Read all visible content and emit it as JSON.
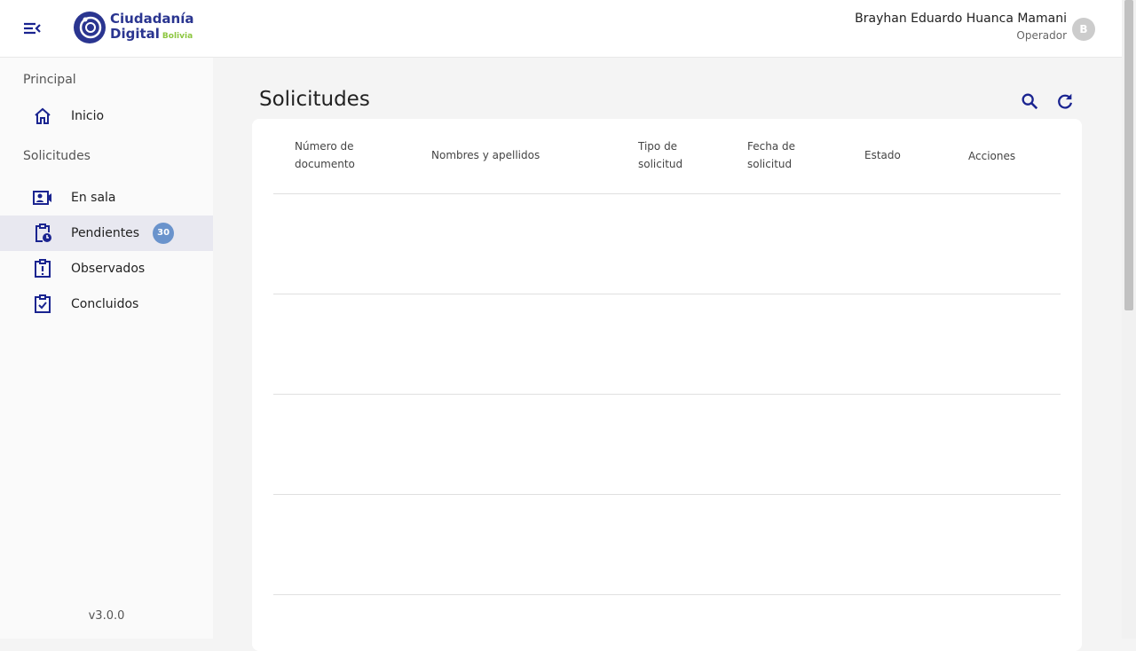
{
  "header": {
    "logo_line1": "Ciudadanía",
    "logo_line2": "Digital",
    "logo_sub": "Bolivia",
    "user_name": "Brayhan Eduardo Huanca Mamani",
    "user_role": "Operador",
    "avatar_initial": "B"
  },
  "sidebar": {
    "section_principal": "Principal",
    "inicio": "Inicio",
    "section_solicitudes": "Solicitudes",
    "items": [
      {
        "label": "En sala"
      },
      {
        "label": "Pendientes",
        "badge": "30"
      },
      {
        "label": "Observados"
      },
      {
        "label": "Concluidos"
      }
    ],
    "version": "v3.0.0"
  },
  "main": {
    "title": "Solicitudes",
    "columns": [
      "Número de documento",
      "Nombres y apellidos",
      "Tipo de solicitud",
      "Fecha de solicitud",
      "Estado",
      "Acciones"
    ]
  },
  "colors": {
    "primary": "#1a2490",
    "badge": "#6a93cc",
    "active": "#e8e8f0"
  }
}
